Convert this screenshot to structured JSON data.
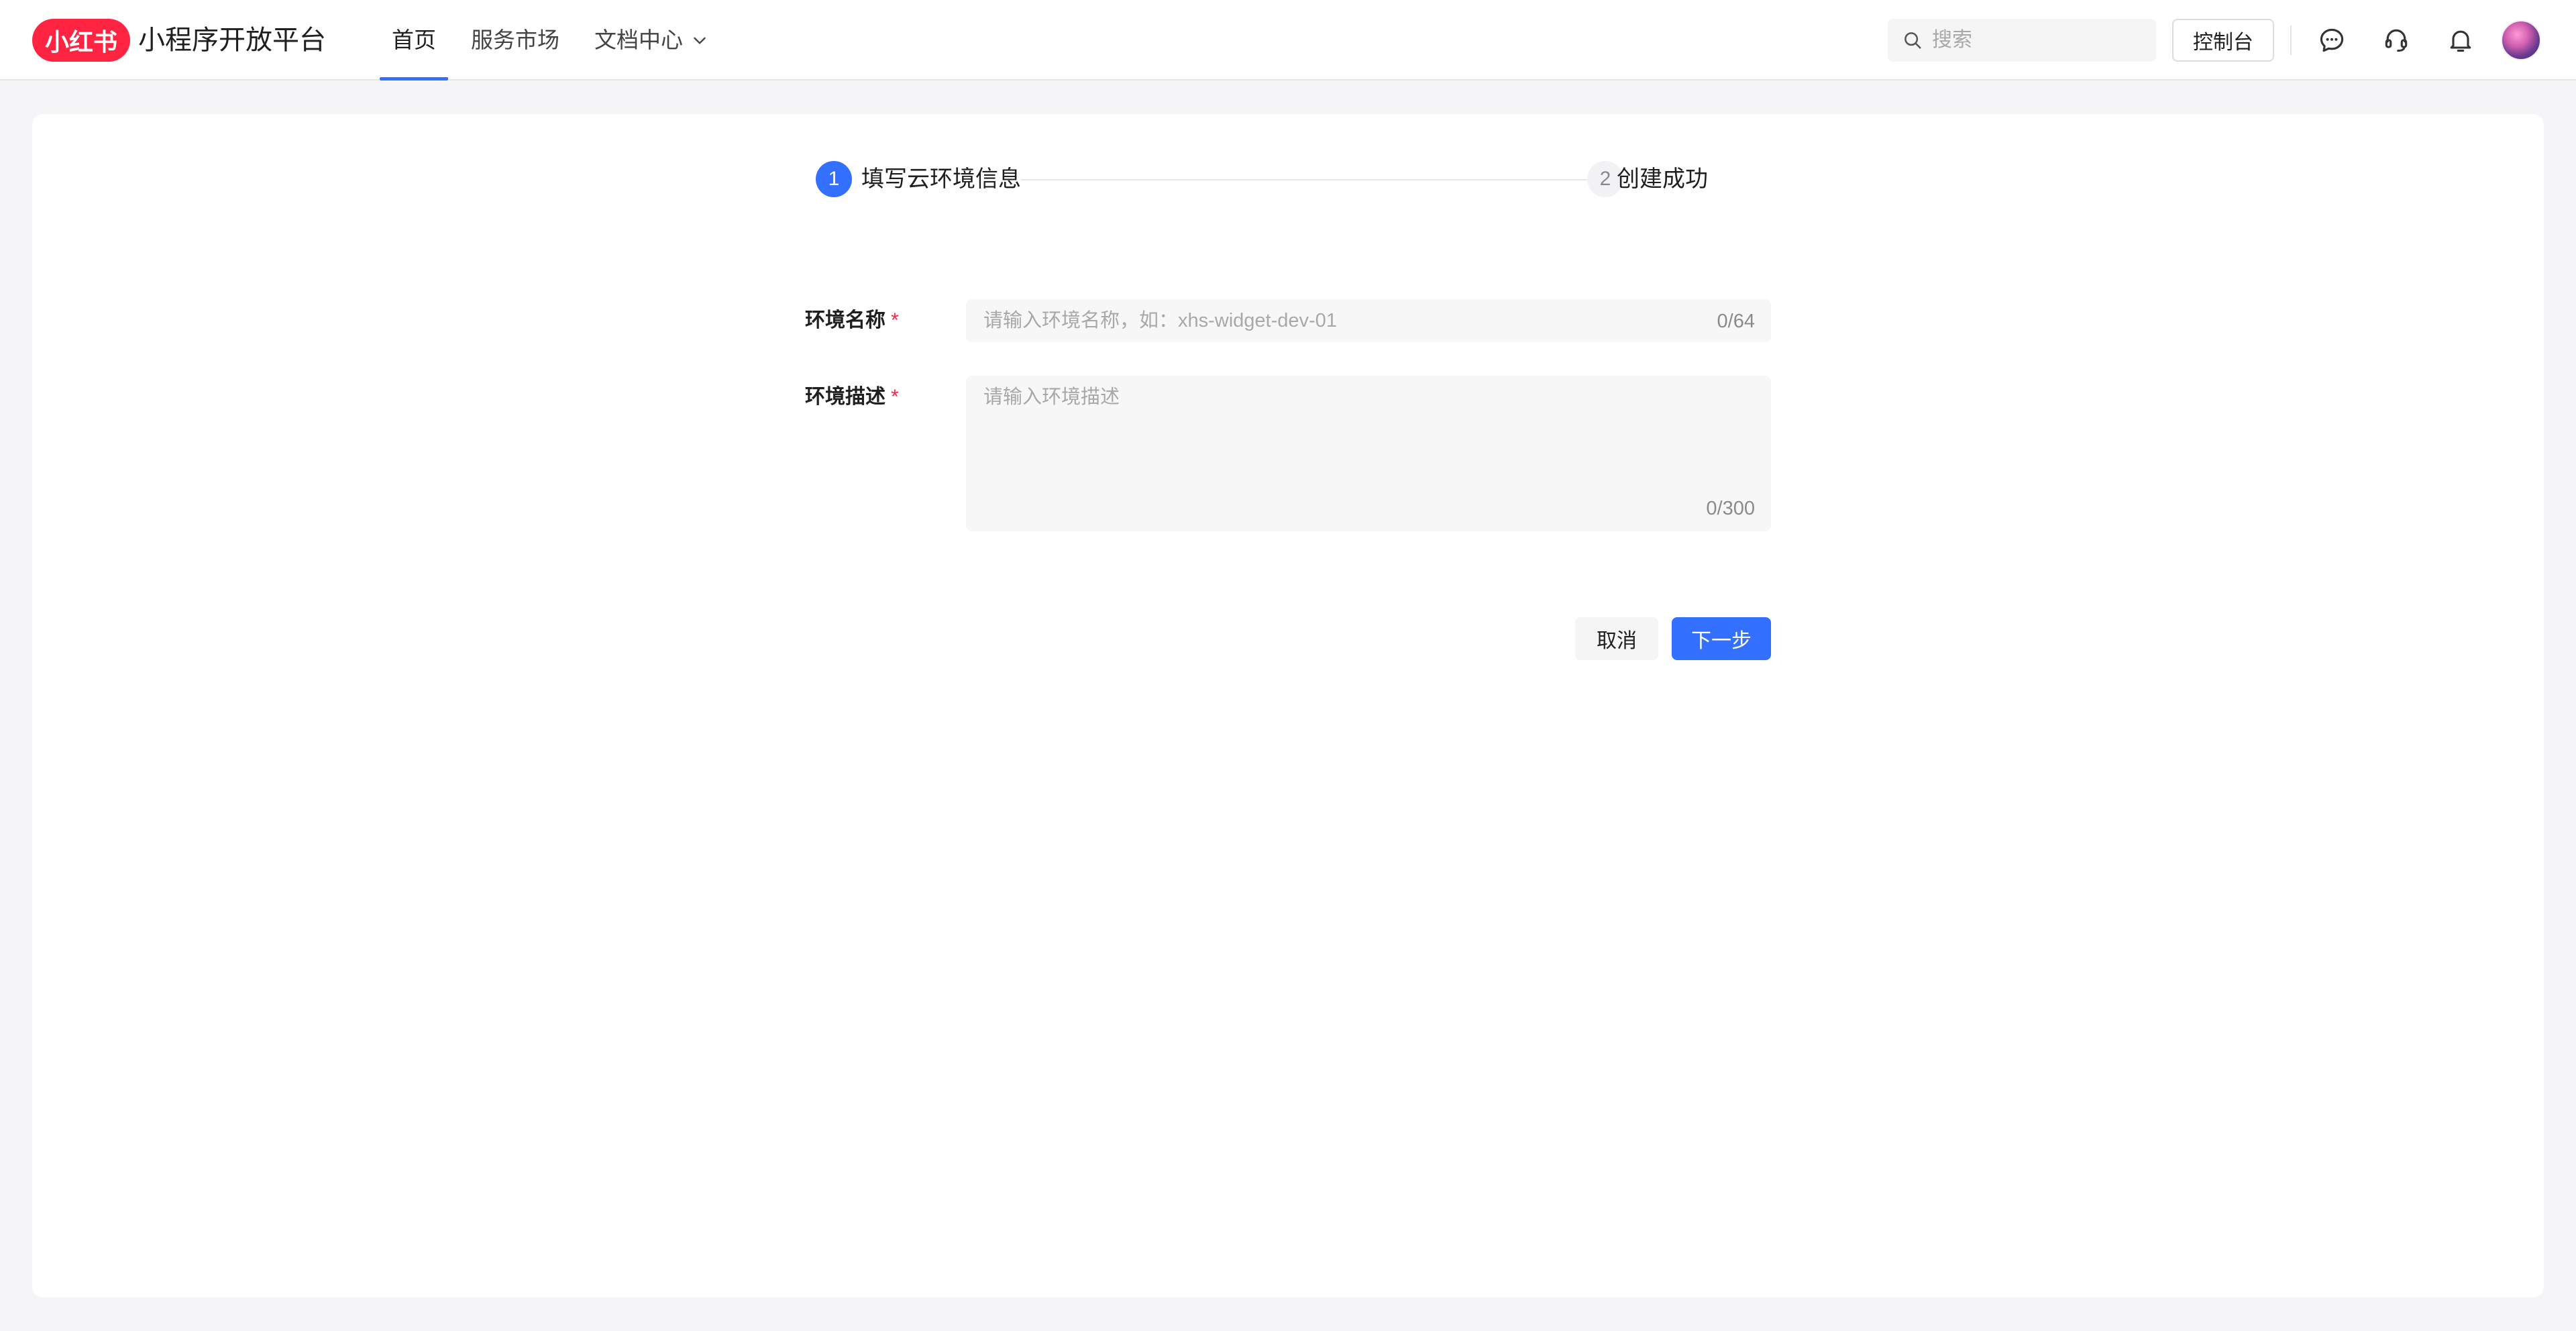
{
  "header": {
    "logo_text": "小红书",
    "brand_title": "小程序开放平台",
    "nav": [
      {
        "label": "首页",
        "active": true
      },
      {
        "label": "服务市场",
        "active": false
      },
      {
        "label": "文档中心",
        "active": false,
        "dropdown": true
      }
    ],
    "search": {
      "placeholder": "搜索",
      "value": ""
    },
    "console_label": "控制台",
    "icons": [
      "message-icon",
      "headset-icon",
      "bell-icon"
    ]
  },
  "steps": [
    {
      "number": "1",
      "label": "填写云环境信息",
      "state": "active"
    },
    {
      "number": "2",
      "label": "创建成功",
      "state": "pending"
    }
  ],
  "form": {
    "name": {
      "label": "环境名称",
      "required_mark": "*",
      "placeholder": "请输入环境名称，如：xhs-widget-dev-01",
      "value": "",
      "counter": "0/64"
    },
    "description": {
      "label": "环境描述",
      "required_mark": "*",
      "placeholder": "请输入环境描述",
      "value": "",
      "counter": "0/300"
    }
  },
  "actions": {
    "cancel_label": "取消",
    "next_label": "下一步"
  },
  "colors": {
    "brand": "#ff2442",
    "primary": "#3370ff",
    "page_bg": "#f5f5f7"
  }
}
